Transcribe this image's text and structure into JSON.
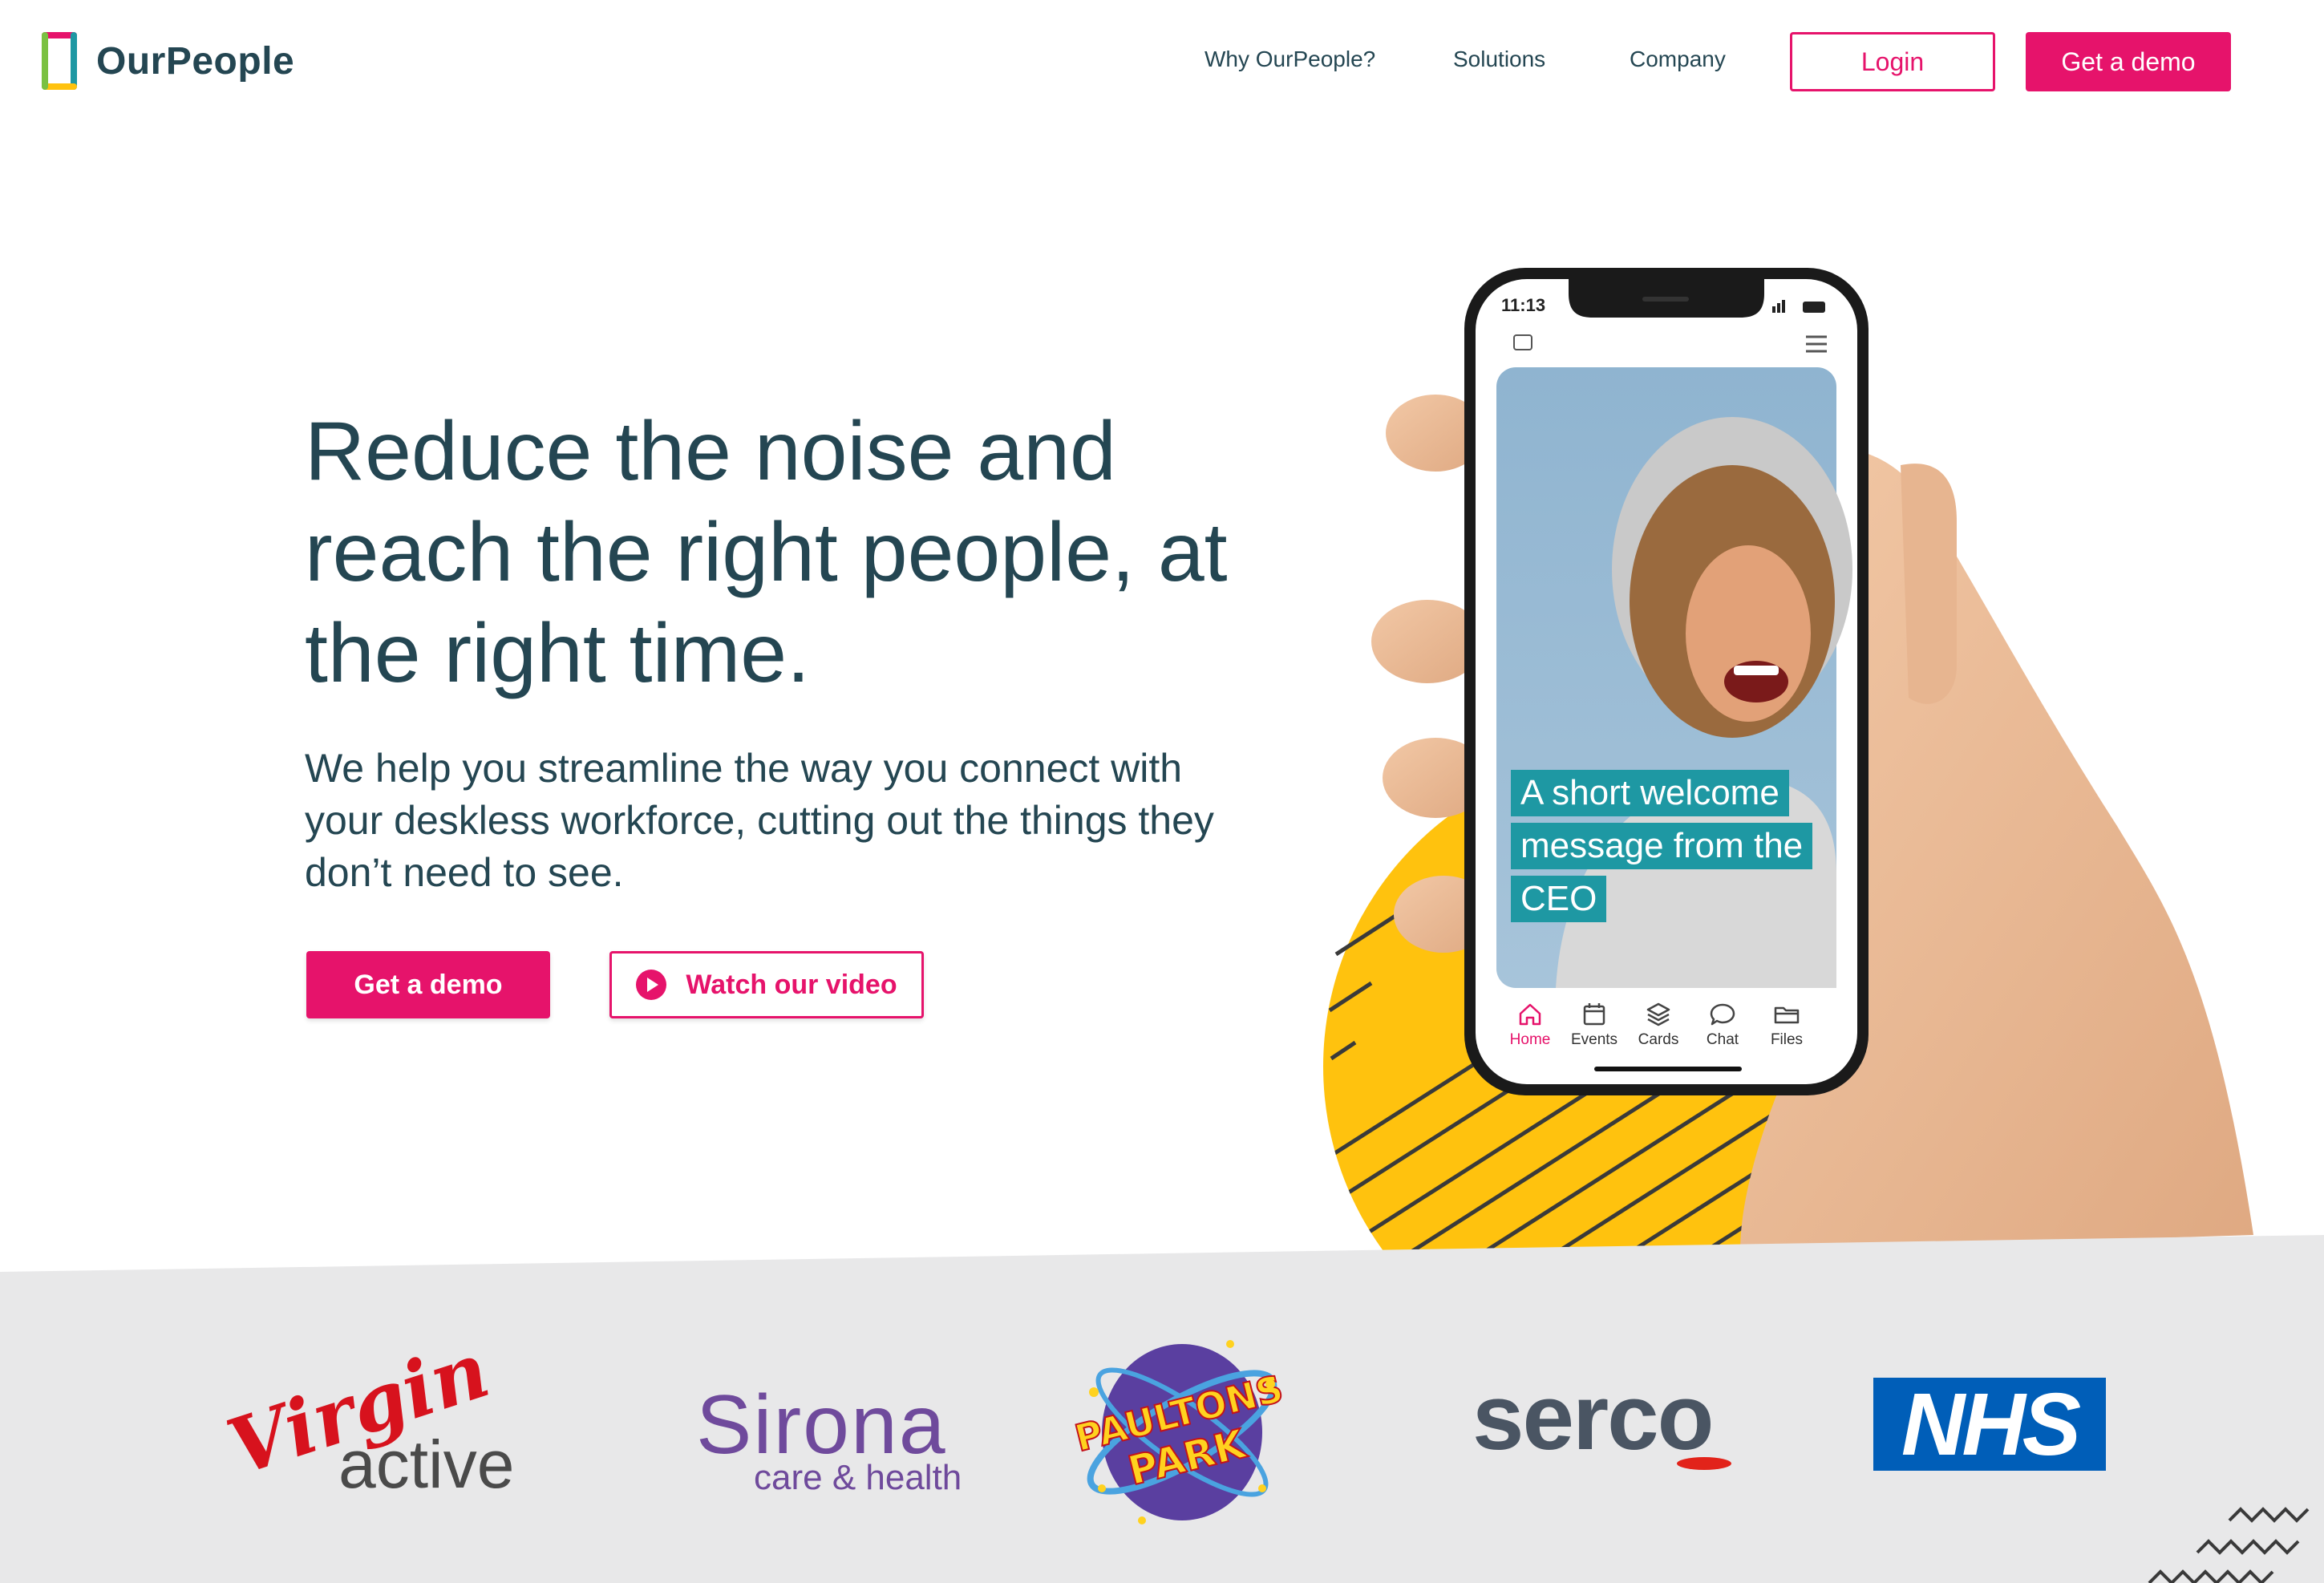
{
  "brand": {
    "name": "OurPeople",
    "accent": "#e6136b",
    "text_color": "#244652",
    "logo_icon": "ourpeople-frame-icon"
  },
  "nav": {
    "items": [
      {
        "label": "Why OurPeople?"
      },
      {
        "label": "Solutions"
      },
      {
        "label": "Company"
      }
    ],
    "login_label": "Login",
    "demo_label": "Get a demo"
  },
  "hero": {
    "headline": "Reduce the noise and reach the right people, at the right time.",
    "subtext": "We help you streamline the way you connect with your deskless workforce, cutting out the things they don’t need to see.",
    "demo_label": "Get a demo",
    "video_label": "Watch our video",
    "video_icon": "play-circle-icon"
  },
  "phone": {
    "time": "11:13",
    "caption_lines": [
      "A short welcome",
      "message from the",
      "CEO"
    ],
    "caption_color": "#1e98a3",
    "tabs": [
      {
        "label": "Home",
        "icon": "home-icon",
        "active": true
      },
      {
        "label": "Events",
        "icon": "calendar-icon",
        "active": false
      },
      {
        "label": "Cards",
        "icon": "layers-icon",
        "active": false
      },
      {
        "label": "Chat",
        "icon": "chat-bubble-icon",
        "active": false
      },
      {
        "label": "Files",
        "icon": "folder-icon",
        "active": false
      }
    ],
    "decor_color": "#ffc20e"
  },
  "clients": {
    "virgin": {
      "script": "Virgin",
      "word": "active"
    },
    "sirona": {
      "word": "Sirona",
      "sub": "care & health"
    },
    "paultons": {
      "line1": "PAULTONS",
      "line2": "PARK"
    },
    "serco": {
      "word": "serco"
    },
    "nhs": {
      "word": "NHS"
    }
  }
}
